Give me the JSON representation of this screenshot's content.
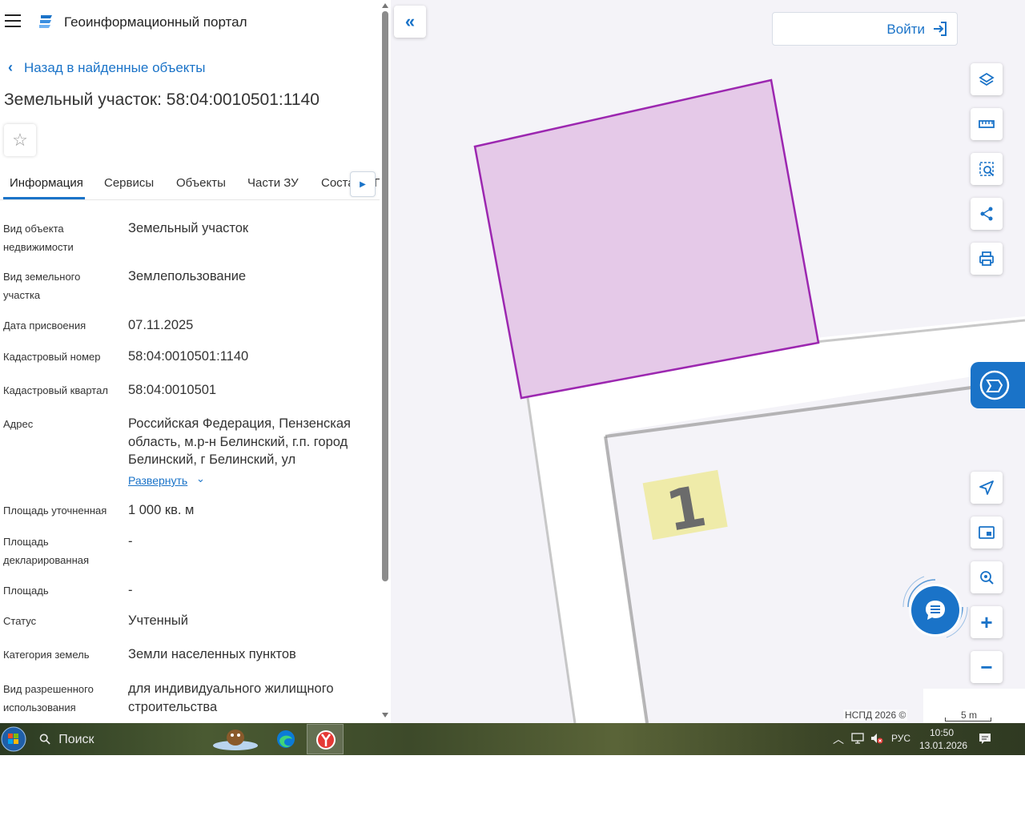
{
  "app": {
    "title": "Геоинформационный портал",
    "accent": "#1a73c8"
  },
  "nav": {
    "back_label": "Назад в найденные объекты"
  },
  "object": {
    "title": "Земельный участок: 58:04:0010501:1140"
  },
  "tabs": [
    {
      "label": "Информация",
      "active": true
    },
    {
      "label": "Сервисы"
    },
    {
      "label": "Объекты"
    },
    {
      "label": "Части ЗУ"
    },
    {
      "label": "Соста"
    },
    {
      "label": "Г"
    }
  ],
  "properties": [
    {
      "label": "Вид объекта недвижимости",
      "value": "Земельный участок"
    },
    {
      "label": "Вид земельного участка",
      "value": "Землепользование"
    },
    {
      "label": "Дата присвоения",
      "value": "07.11.2025"
    },
    {
      "label": "Кадастровый номер",
      "value": "58:04:0010501:1140"
    },
    {
      "label": "Кадастровый квартал",
      "value": "58:04:0010501"
    },
    {
      "label": "Адрес",
      "value": "Российская Федерация, Пензенская область, м.р-н Белинский, г.п. город Белинский, г Белинский, ул"
    },
    {
      "label": "Площадь уточненная",
      "value": "1 000 кв. м"
    },
    {
      "label": "Площадь декларированная",
      "value": "-"
    },
    {
      "label": "Площадь",
      "value": "-"
    },
    {
      "label": "Статус",
      "value": "Учтенный"
    },
    {
      "label": "Категория земель",
      "value": "Земли населенных пунктов"
    },
    {
      "label": "Вид разрешенного использования",
      "value": "для индивидуального жилищного строительства"
    }
  ],
  "expand_label": "Развернуть",
  "map": {
    "login_label": "Войти",
    "parcel_fill": "#e5c9e8",
    "parcel_stroke": "#9c27b0",
    "building_number": "1",
    "attribution": "НСПД 2026 ©",
    "scale_label": "5 m",
    "tools_top": [
      "layers-icon",
      "ruler-icon",
      "select-area-icon",
      "share-icon",
      "print-icon"
    ],
    "tools_bottom": [
      "locate-icon",
      "minimap-icon",
      "geo-search-icon",
      "zoom-in-icon",
      "zoom-out-icon"
    ]
  },
  "taskbar": {
    "search_placeholder": "Поиск",
    "lang": "РУС",
    "time": "10:50",
    "date": "13.01.2026"
  }
}
